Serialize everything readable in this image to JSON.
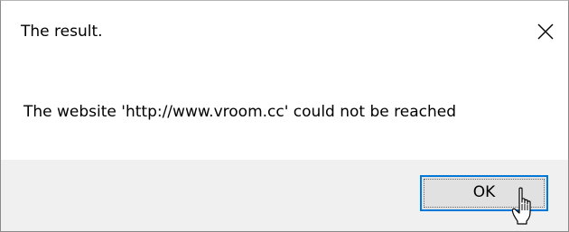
{
  "dialog": {
    "title": "The result.",
    "message": "The website 'http://www.vroom.cc' could not be reached",
    "ok_label": "OK",
    "close_icon": "close-icon",
    "cursor_icon": "hand-pointer-cursor-icon",
    "colors": {
      "footer_bg": "#f0f0f0",
      "button_bg": "#e1e1e1",
      "button_focus_border": "#0078d7"
    }
  }
}
